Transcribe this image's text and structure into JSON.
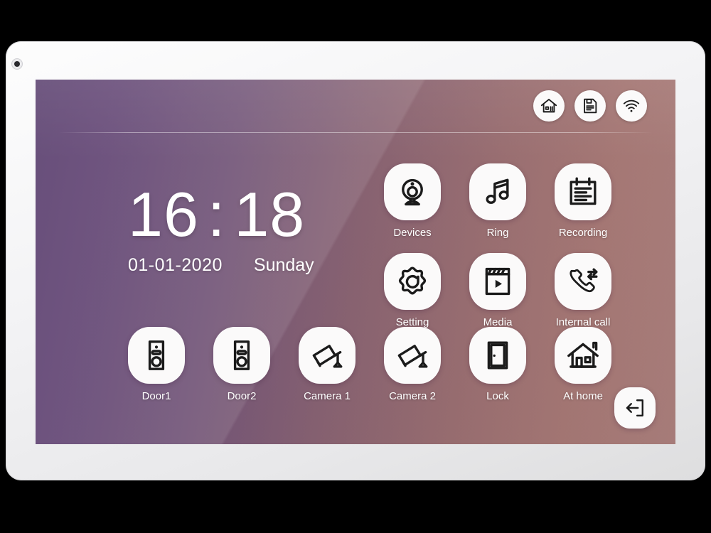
{
  "device": {
    "type": "video-intercom-monitor",
    "bezel_color": "#f2f2f4",
    "screen_bg_left": "#55396a",
    "screen_bg_right": "#b08380"
  },
  "statusbar": {
    "icons": [
      {
        "name": "home-icon",
        "label": "Home"
      },
      {
        "name": "sd-card-icon",
        "label": "Storage"
      },
      {
        "name": "wifi-icon",
        "label": "Wi-Fi"
      }
    ]
  },
  "clock": {
    "hours": "16",
    "colon": ":",
    "minutes": "18",
    "date": "01-01-2020",
    "weekday": "Sunday"
  },
  "apps_top": [
    {
      "label": "Devices",
      "icon": "webcam-icon"
    },
    {
      "label": "Ring",
      "icon": "music-note-icon"
    },
    {
      "label": "Recording",
      "icon": "notepad-icon"
    },
    {
      "label": "Setting",
      "icon": "gear-icon"
    },
    {
      "label": "Media",
      "icon": "clapperboard-icon"
    },
    {
      "label": "Internal call",
      "icon": "call-transfer-icon"
    }
  ],
  "apps_bottom": [
    {
      "label": "Door1",
      "icon": "doorbell-panel-icon"
    },
    {
      "label": "Door2",
      "icon": "doorbell-panel-icon"
    },
    {
      "label": "Camera 1",
      "icon": "cctv-camera-icon"
    },
    {
      "label": "Camera 2",
      "icon": "cctv-camera-icon"
    },
    {
      "label": "Lock",
      "icon": "door-icon"
    },
    {
      "label": "At home",
      "icon": "house-icon"
    }
  ],
  "exit": {
    "label": "Exit",
    "icon": "exit-icon"
  }
}
